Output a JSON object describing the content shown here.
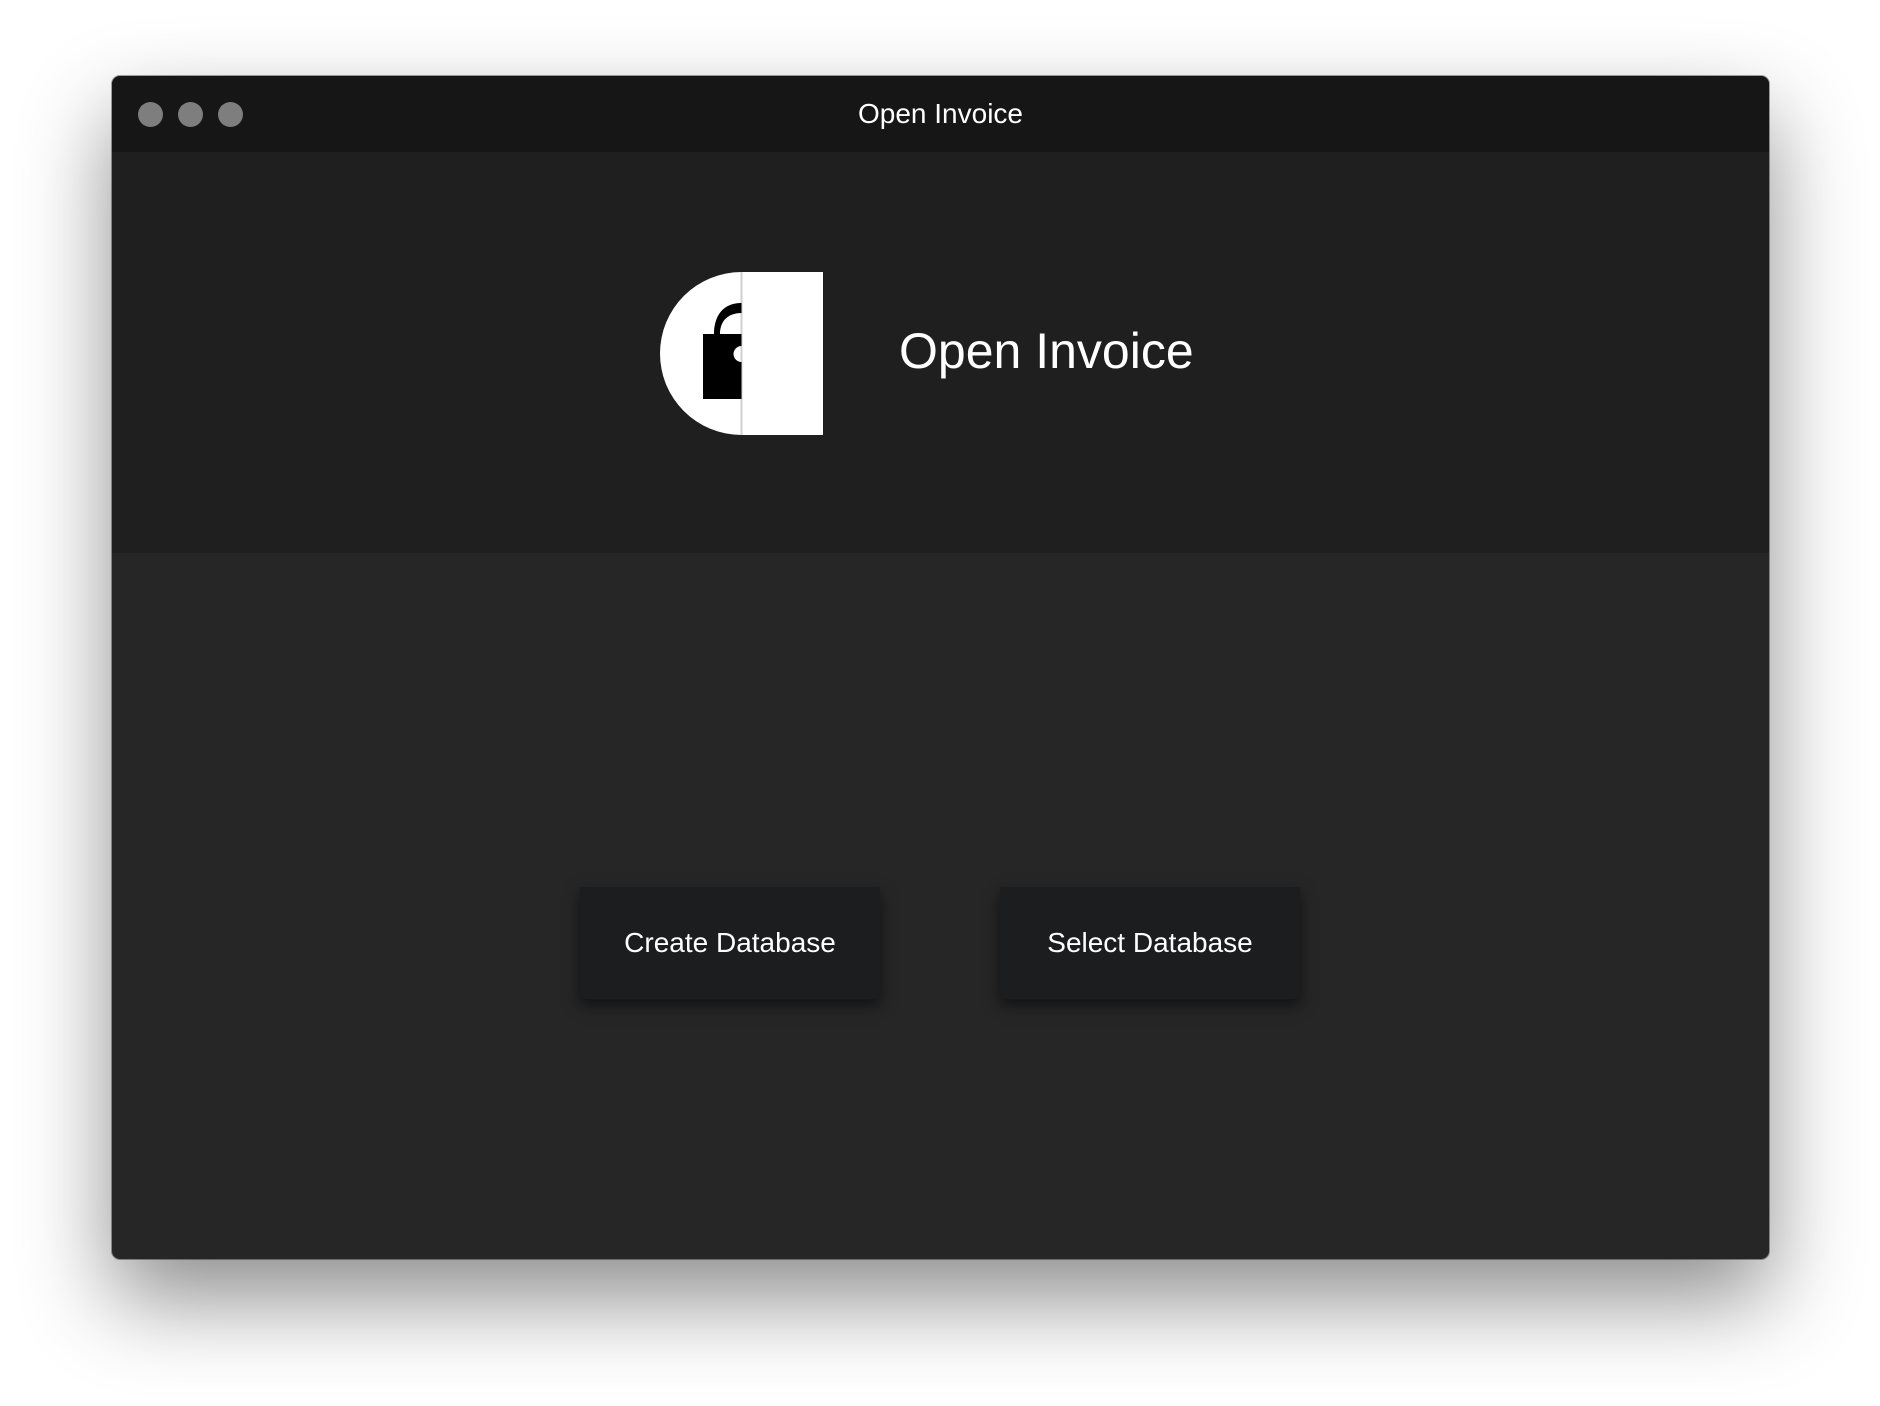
{
  "window": {
    "title": "Open Invoice"
  },
  "header": {
    "app_name": "Open Invoice",
    "logo_icon": "lock-document-logo-icon"
  },
  "actions": {
    "create_label": "Create Database",
    "select_label": "Select Database"
  },
  "colors": {
    "window_background": "#262626",
    "titlebar_background": "#161616",
    "header_background": "#1f1f1f",
    "button_background": "#1c1d1f",
    "text": "#ffffff"
  }
}
